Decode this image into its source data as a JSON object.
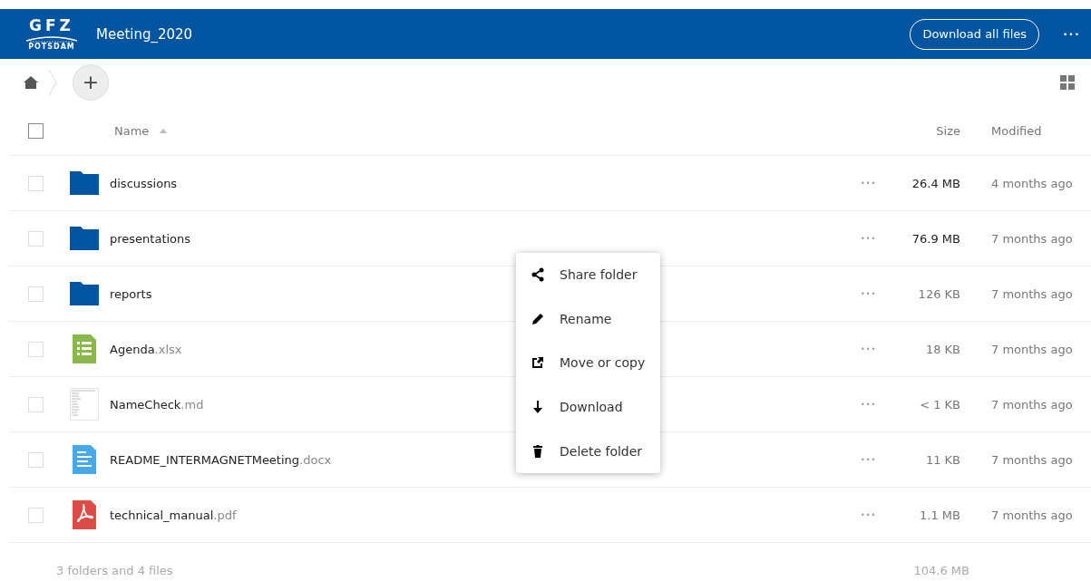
{
  "header": {
    "logo": {
      "mark": "GFZ",
      "subline": "POTSDAM"
    },
    "title": "Meeting_2020",
    "download_button": "Download all files",
    "more": "•••"
  },
  "toolbar": {
    "add": "+"
  },
  "table": {
    "columns": {
      "name": "Name",
      "size": "Size",
      "modified": "Modified"
    },
    "all_checked": false,
    "rows": [
      {
        "kind": "folder",
        "name": "discussions",
        "ext": "",
        "size": "26.4 MB",
        "large": true,
        "modified": "4 months ago",
        "checked": false
      },
      {
        "kind": "folder",
        "name": "presentations",
        "ext": "",
        "size": "76.9 MB",
        "large": true,
        "modified": "7 months ago",
        "checked": false
      },
      {
        "kind": "folder",
        "name": "reports",
        "ext": "",
        "size": "126 KB",
        "large": false,
        "modified": "7 months ago",
        "checked": false
      },
      {
        "kind": "sheet",
        "name": "Agenda",
        "ext": ".xlsx",
        "size": "18 KB",
        "large": false,
        "modified": "7 months ago",
        "checked": false
      },
      {
        "kind": "text",
        "name": "NameCheck",
        "ext": ".md",
        "size": "< 1 KB",
        "large": false,
        "modified": "7 months ago",
        "checked": false
      },
      {
        "kind": "doc",
        "name": "README_INTERMAGNETMeeting",
        "ext": ".docx",
        "size": "11 KB",
        "large": false,
        "modified": "7 months ago",
        "checked": false
      },
      {
        "kind": "pdf",
        "name": "technical_manual",
        "ext": ".pdf",
        "size": "1.1 MB",
        "large": false,
        "modified": "7 months ago",
        "checked": false
      }
    ],
    "row_action": "•••",
    "summary": {
      "count": "3 folders and 4 files",
      "total": "104.6 MB"
    }
  },
  "context_menu": {
    "items": [
      {
        "kind": "share",
        "label": "Share folder"
      },
      {
        "kind": "rename",
        "label": "Rename"
      },
      {
        "kind": "move",
        "label": "Move or copy"
      },
      {
        "kind": "download",
        "label": "Download"
      },
      {
        "kind": "delete",
        "label": "Delete folder"
      }
    ]
  }
}
